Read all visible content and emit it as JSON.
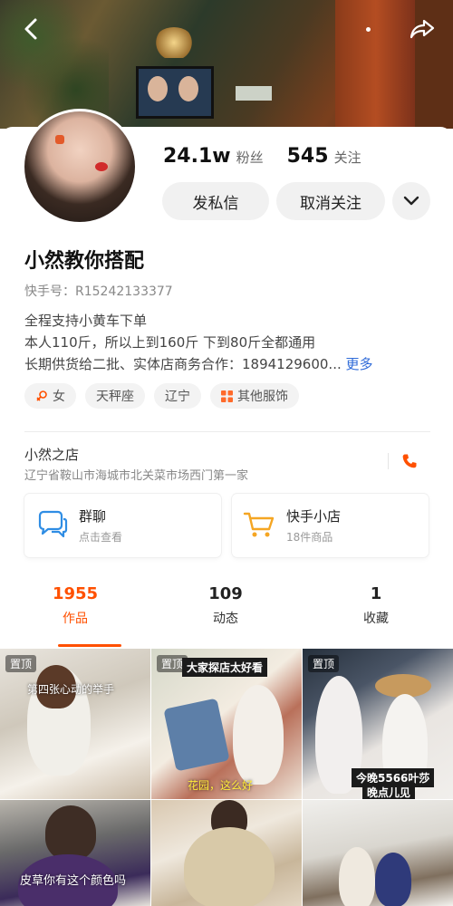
{
  "cover": {
    "share_icon": "share-arrow-icon",
    "more_icon": "ellipsis-icon",
    "back_icon": "chevron-left-icon"
  },
  "stats": {
    "followers_value": "24.1w",
    "followers_label": "粉丝",
    "following_value": "545",
    "following_label": "关注"
  },
  "actions": {
    "message_label": "发私信",
    "unfollow_label": "取消关注"
  },
  "profile": {
    "nickname": "小然教你搭配",
    "kuaishou_id": "快手号：R15242133377",
    "bio_line1": "全程支持小黄车下单",
    "bio_line2": "本人110斤，所以上到160斤 下到80斤全都通用",
    "bio_line3": "长期供货给二批、实体店商务合作：1894129600...",
    "more_label": "更多"
  },
  "tags": [
    "女",
    "天秤座",
    "辽宁",
    "其他服饰"
  ],
  "shop": {
    "name": "小然之店",
    "address": "辽宁省鞍山市海城市北关菜市场西门第一家"
  },
  "cards": [
    {
      "title": "群聊",
      "subtitle": "点击查看",
      "icon": "chat-bubbles-icon"
    },
    {
      "title": "快手小店",
      "subtitle": "18件商品",
      "icon": "shopping-cart-icon"
    }
  ],
  "tabs": [
    {
      "count": "1955",
      "label": "作品"
    },
    {
      "count": "109",
      "label": "动态"
    },
    {
      "count": "1",
      "label": "收藏"
    }
  ],
  "videos": [
    {
      "pinned": "置顶",
      "caption": "第四张心动的举手"
    },
    {
      "pinned": "置顶",
      "caption": "大家探店太好看",
      "caption2": "花园，这么好"
    },
    {
      "pinned": "置顶",
      "caption": "今晚5566叶莎",
      "caption2": "晚点儿见"
    },
    {
      "pinned": "",
      "caption": "皮草你有这个颜色吗"
    },
    {
      "pinned": "",
      "caption": ""
    },
    {
      "pinned": "",
      "caption": ""
    }
  ],
  "colors": {
    "accent": "#ff5000",
    "link": "#2e6ad8",
    "cart": "#f5a623",
    "chat": "#2f8de4"
  }
}
